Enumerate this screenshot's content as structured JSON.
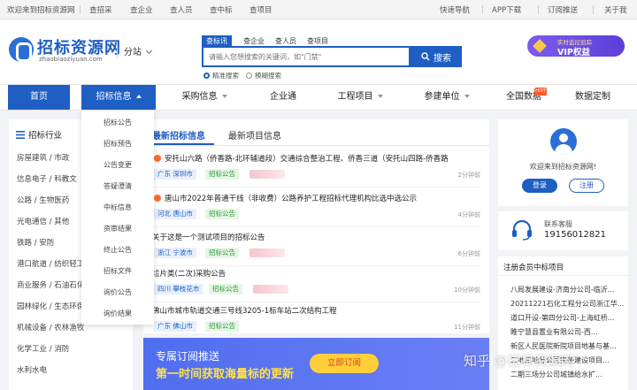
{
  "topbar": {
    "welcome": "欢迎来到招标资源网",
    "links": [
      "查招采",
      "查企业",
      "查人员",
      "查中标",
      "查项目"
    ],
    "right": [
      "快速导航",
      "APP下载",
      "订阅推送",
      "关于我"
    ]
  },
  "header": {
    "logo_title": "招标资源网",
    "logo_sub": "zhaobiaoziyuan.com",
    "branch": "分站",
    "search_tabs": [
      "查标讯",
      "查企业",
      "查人员",
      "查项目"
    ],
    "search_placeholder": "请输入您想搜索的关键词，如\"门禁\"",
    "search_button": "搜索",
    "radio_precise": "精准搜索",
    "radio_fuzzy": "模糊搜索",
    "vip_line1": "实时监控追踪",
    "vip_line2": "VIP权益"
  },
  "nav": {
    "items": [
      "首页",
      "招标信息",
      "采购信息",
      "企业通",
      "工程项目",
      "参建单位",
      "全国数据",
      "数据定制"
    ],
    "hot_badge": "HOT"
  },
  "industry": {
    "title": "招标行业",
    "items": [
      "房屋建筑 / 市政",
      "信息电子 / 科教文",
      "公路 / 生物医药",
      "光电通信 / 其他",
      "铁路 / 安防",
      "港口航道 / 纺织轻工",
      "商业服务 / 石油石化",
      "园林绿化 / 生态环保",
      "机械设备 / 农林渔牧",
      "化学工业 / 消防",
      "水利水电"
    ]
  },
  "dropdown": {
    "items": [
      "招标公告",
      "招标预告",
      "公告变更",
      "答疑澄清",
      "中标信息",
      "资审结果",
      "终止公告",
      "招标文件",
      "询价公告",
      "询价结果"
    ]
  },
  "center": {
    "tabs": [
      "最新招标信息",
      "最新项目信息"
    ],
    "rows": [
      {
        "title": "安托山六路（侨香路-北环辅道段）交通综合整治工程、侨香三道（安托山四路-侨香路",
        "location": "广东 深圳市",
        "category": "招标公告",
        "time": "2分钟前"
      },
      {
        "title": "唐山市2022年普通干线（非收费）公路养护工程招标代理机构比选中选公示",
        "location": "河北 唐山市",
        "category": "招标公告",
        "time": "4分钟前"
      },
      {
        "title": "关于这是一个测试项目的招标公告",
        "location": "浙江 宁波市",
        "category": "招标公告",
        "time": "6分钟前"
      },
      {
        "title": "垃片类(二次)采购公告",
        "location": "四川 攀枝花市",
        "category": "招标公告",
        "time": "10分钟前"
      },
      {
        "title": "佛山市城市轨道交通三号线3205-1标车站二次结构工程",
        "location": "广东 佛山市",
        "category": "招标公告",
        "time": "11分钟前"
      }
    ]
  },
  "banner": {
    "line1": "专属订阅推送",
    "line2": "第一时间获取海量标的更新",
    "button": "立即订阅"
  },
  "user_card": {
    "welcome": "欢迎来到招标资源网!",
    "login": "登录",
    "register": "注册"
  },
  "service": {
    "label": "联系客服",
    "phone": "19156012821"
  },
  "winners": {
    "title": "注册会员中标项目",
    "items": [
      "八局发展建设-济南分公司-临沂...",
      "20211221石化工程分公司浙江华...",
      "道口开设-第四分公司-上海虹桥...",
      "睢宁慧县置业有限公司-西...",
      "新区人民医院新院项目地基与基...",
      "二地三地分公司完善建设项目...",
      "二期三场分公司城镇给水扩..."
    ]
  },
  "watermark": "知乎 @招标资源网"
}
